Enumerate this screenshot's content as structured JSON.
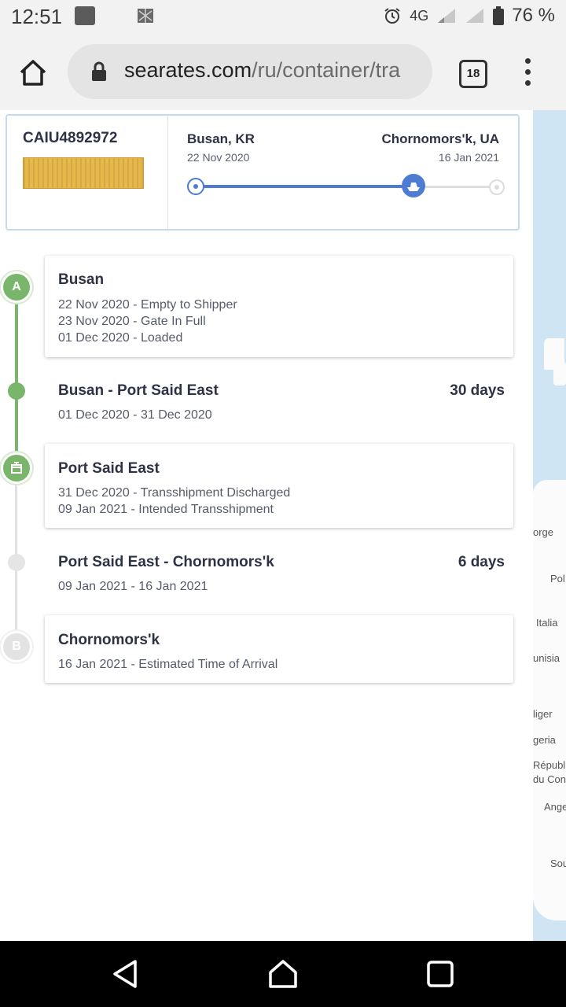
{
  "status_bar": {
    "time": "12:51",
    "network": "4G",
    "battery": "76 %",
    "icons": [
      "notification-icon",
      "app-icon",
      "alarm-icon",
      "signal-icon",
      "signal-icon",
      "battery-icon"
    ]
  },
  "browser": {
    "url_host": "searates.com",
    "url_path": "/ru/container/tra",
    "tab_count": "18"
  },
  "summary": {
    "container_id": "CAIU4892972",
    "from_city": "Busan, KR",
    "from_date": "22 Nov 2020",
    "to_city": "Chornomors'k, UA",
    "to_date": "16 Jan 2021",
    "progress": 0.73
  },
  "timeline": {
    "start_letter": "A",
    "end_letter": "B",
    "stops": [
      {
        "title": "Busan",
        "events": [
          "22 Nov 2020 - Empty to Shipper",
          "23 Nov 2020 - Gate In Full",
          "01 Dec 2020 - Loaded"
        ]
      },
      {
        "title": "Port Said East",
        "events": [
          "31 Dec 2020 - Transshipment Discharged",
          "09 Jan 2021 - Intended Transshipment"
        ]
      },
      {
        "title": "Chornomors'k",
        "events": [
          "16 Jan 2021 - Estimated Time of Arrival"
        ]
      }
    ],
    "legs": [
      {
        "title": "Busan - Port Said East",
        "dates": "01 Dec 2020 - 31 Dec 2020",
        "duration": "30 days"
      },
      {
        "title": "Port Said East - Chornomors'k",
        "dates": "09 Jan 2021 - 16 Jan 2021",
        "duration": "6 days"
      }
    ]
  },
  "map": {
    "labels": [
      "orge",
      "Pol",
      "Italia",
      "unisia",
      "liger",
      "geria",
      "Républi",
      "du Con",
      "Ange",
      "Sou"
    ]
  },
  "colors": {
    "route_blue": "#4d7cd2",
    "timeline_green": "#79b56a",
    "map_water": "#cfe5f4"
  }
}
